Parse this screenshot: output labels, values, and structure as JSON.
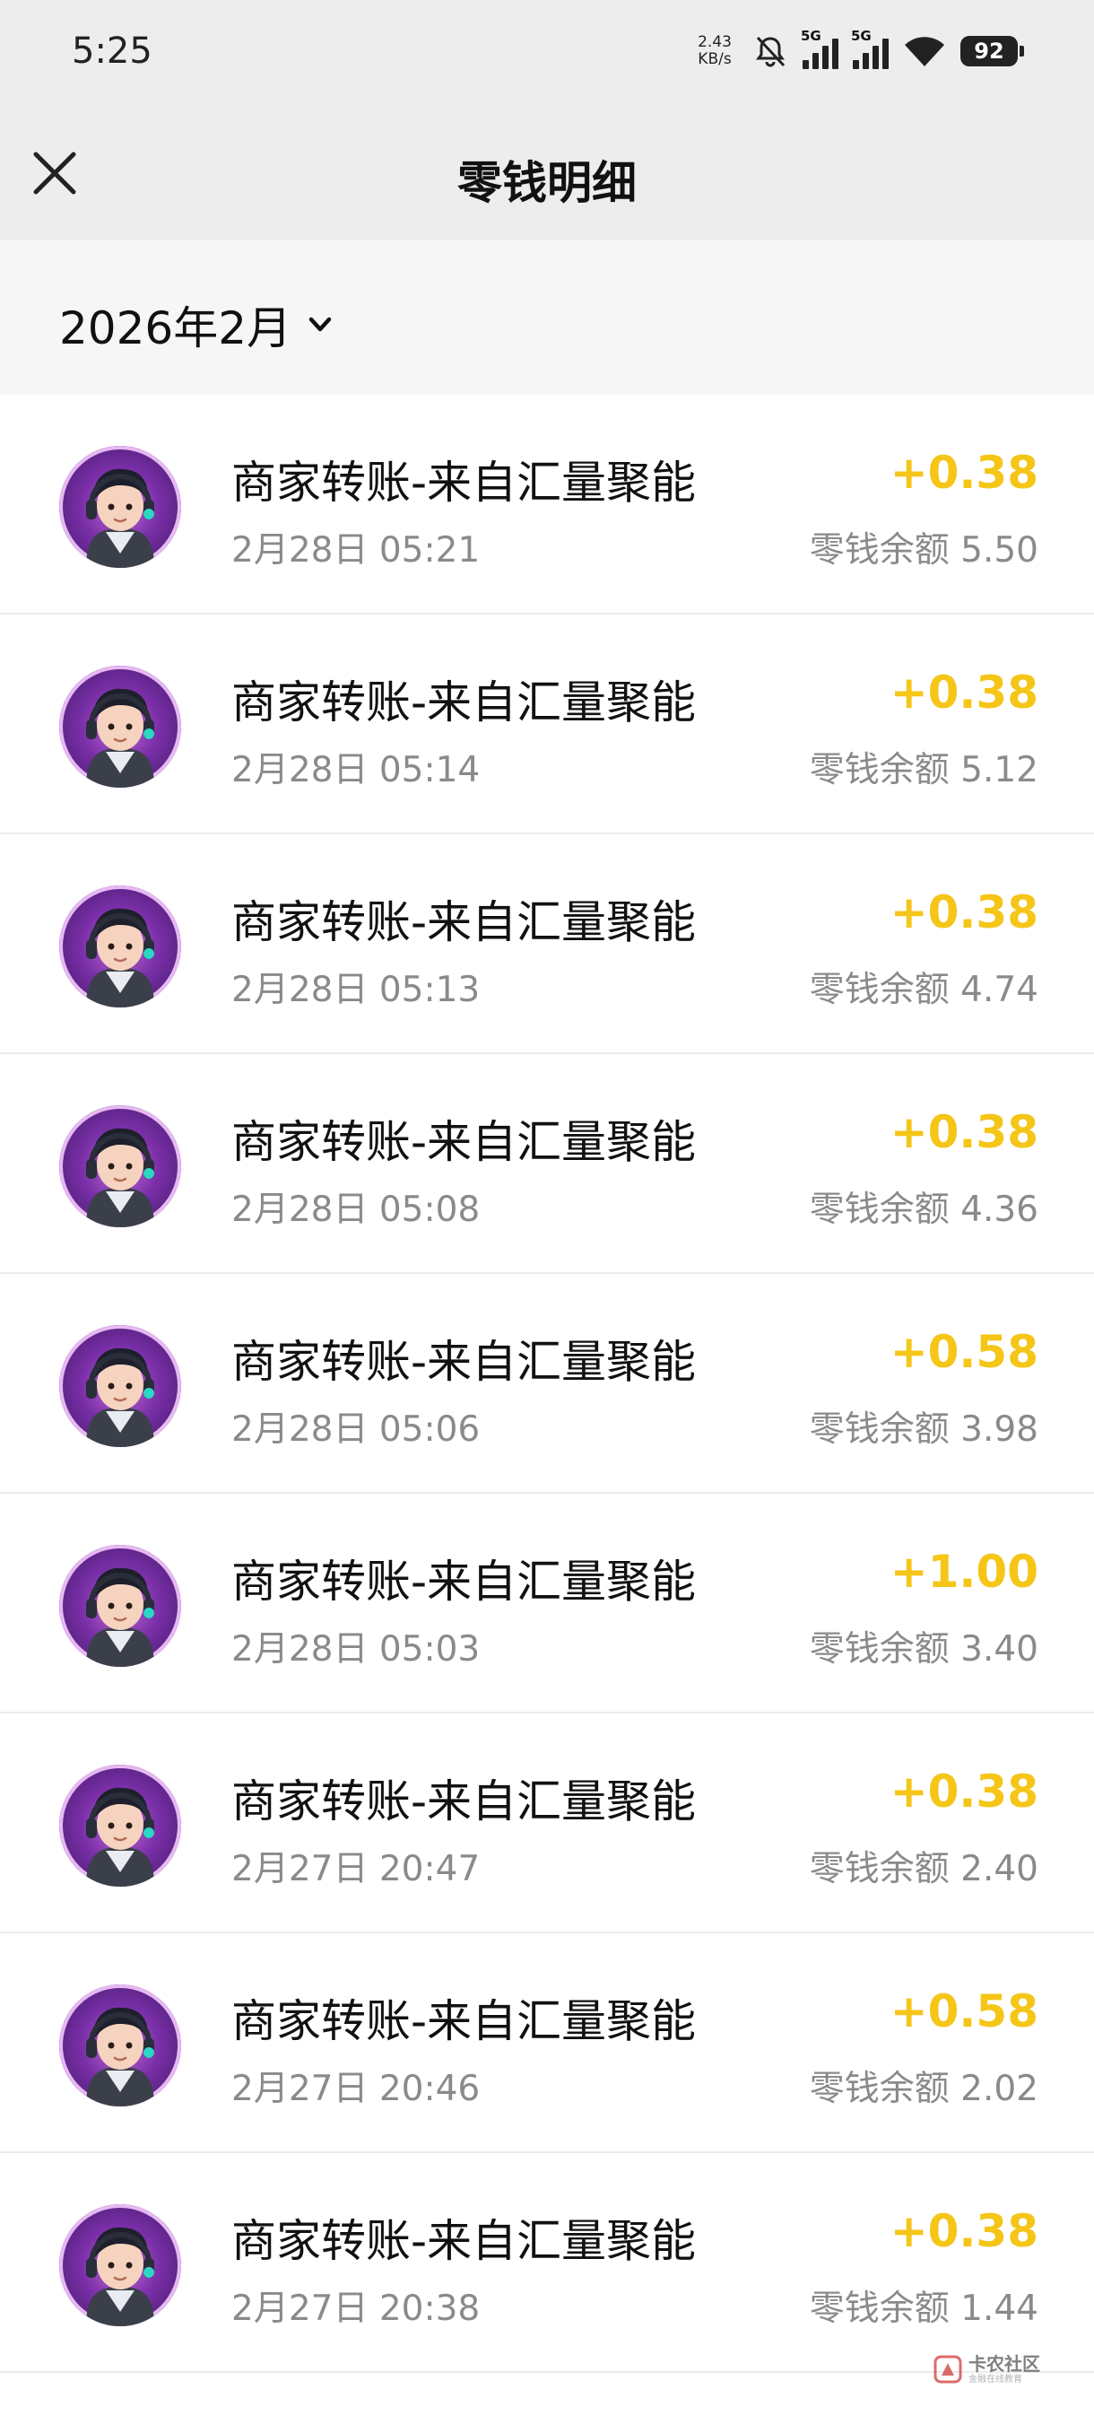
{
  "status_bar": {
    "time": "5:25",
    "net_speed_value": "2.43",
    "net_speed_unit": "KB/s",
    "sim1_label": "5G",
    "sim2_label": "5G",
    "battery": "92",
    "icons": [
      "bell-muted-icon",
      "signal-icon",
      "signal-icon",
      "wifi-icon",
      "battery-icon"
    ]
  },
  "header": {
    "title": "零钱明细",
    "close_icon": "close-icon"
  },
  "filter": {
    "month": "2026年2月",
    "dropdown_icon": "chevron-down-icon"
  },
  "transactions": [
    {
      "title": "商家转账-来自汇量聚能",
      "time": "2月28日 05:21",
      "amount": "+0.38",
      "balance": "零钱余额 5.50"
    },
    {
      "title": "商家转账-来自汇量聚能",
      "time": "2月28日 05:14",
      "amount": "+0.38",
      "balance": "零钱余额 5.12"
    },
    {
      "title": "商家转账-来自汇量聚能",
      "time": "2月28日 05:13",
      "amount": "+0.38",
      "balance": "零钱余额 4.74"
    },
    {
      "title": "商家转账-来自汇量聚能",
      "time": "2月28日 05:08",
      "amount": "+0.38",
      "balance": "零钱余额 4.36"
    },
    {
      "title": "商家转账-来自汇量聚能",
      "time": "2月28日 05:06",
      "amount": "+0.58",
      "balance": "零钱余额 3.98"
    },
    {
      "title": "商家转账-来自汇量聚能",
      "time": "2月28日 05:03",
      "amount": "+1.00",
      "balance": "零钱余额 3.40"
    },
    {
      "title": "商家转账-来自汇量聚能",
      "time": "2月27日 20:47",
      "amount": "+0.38",
      "balance": "零钱余额 2.40"
    },
    {
      "title": "商家转账-来自汇量聚能",
      "time": "2月27日 20:46",
      "amount": "+0.58",
      "balance": "零钱余额 2.02"
    },
    {
      "title": "商家转账-来自汇量聚能",
      "time": "2月27日 20:38",
      "amount": "+0.38",
      "balance": "零钱余额 1.44"
    }
  ],
  "watermark": {
    "main": "卡农社区",
    "sub": "金融在线教育"
  },
  "colors": {
    "amount": "#f5c518",
    "secondary_text": "#8a8a8a",
    "header_bg": "#ededed"
  }
}
